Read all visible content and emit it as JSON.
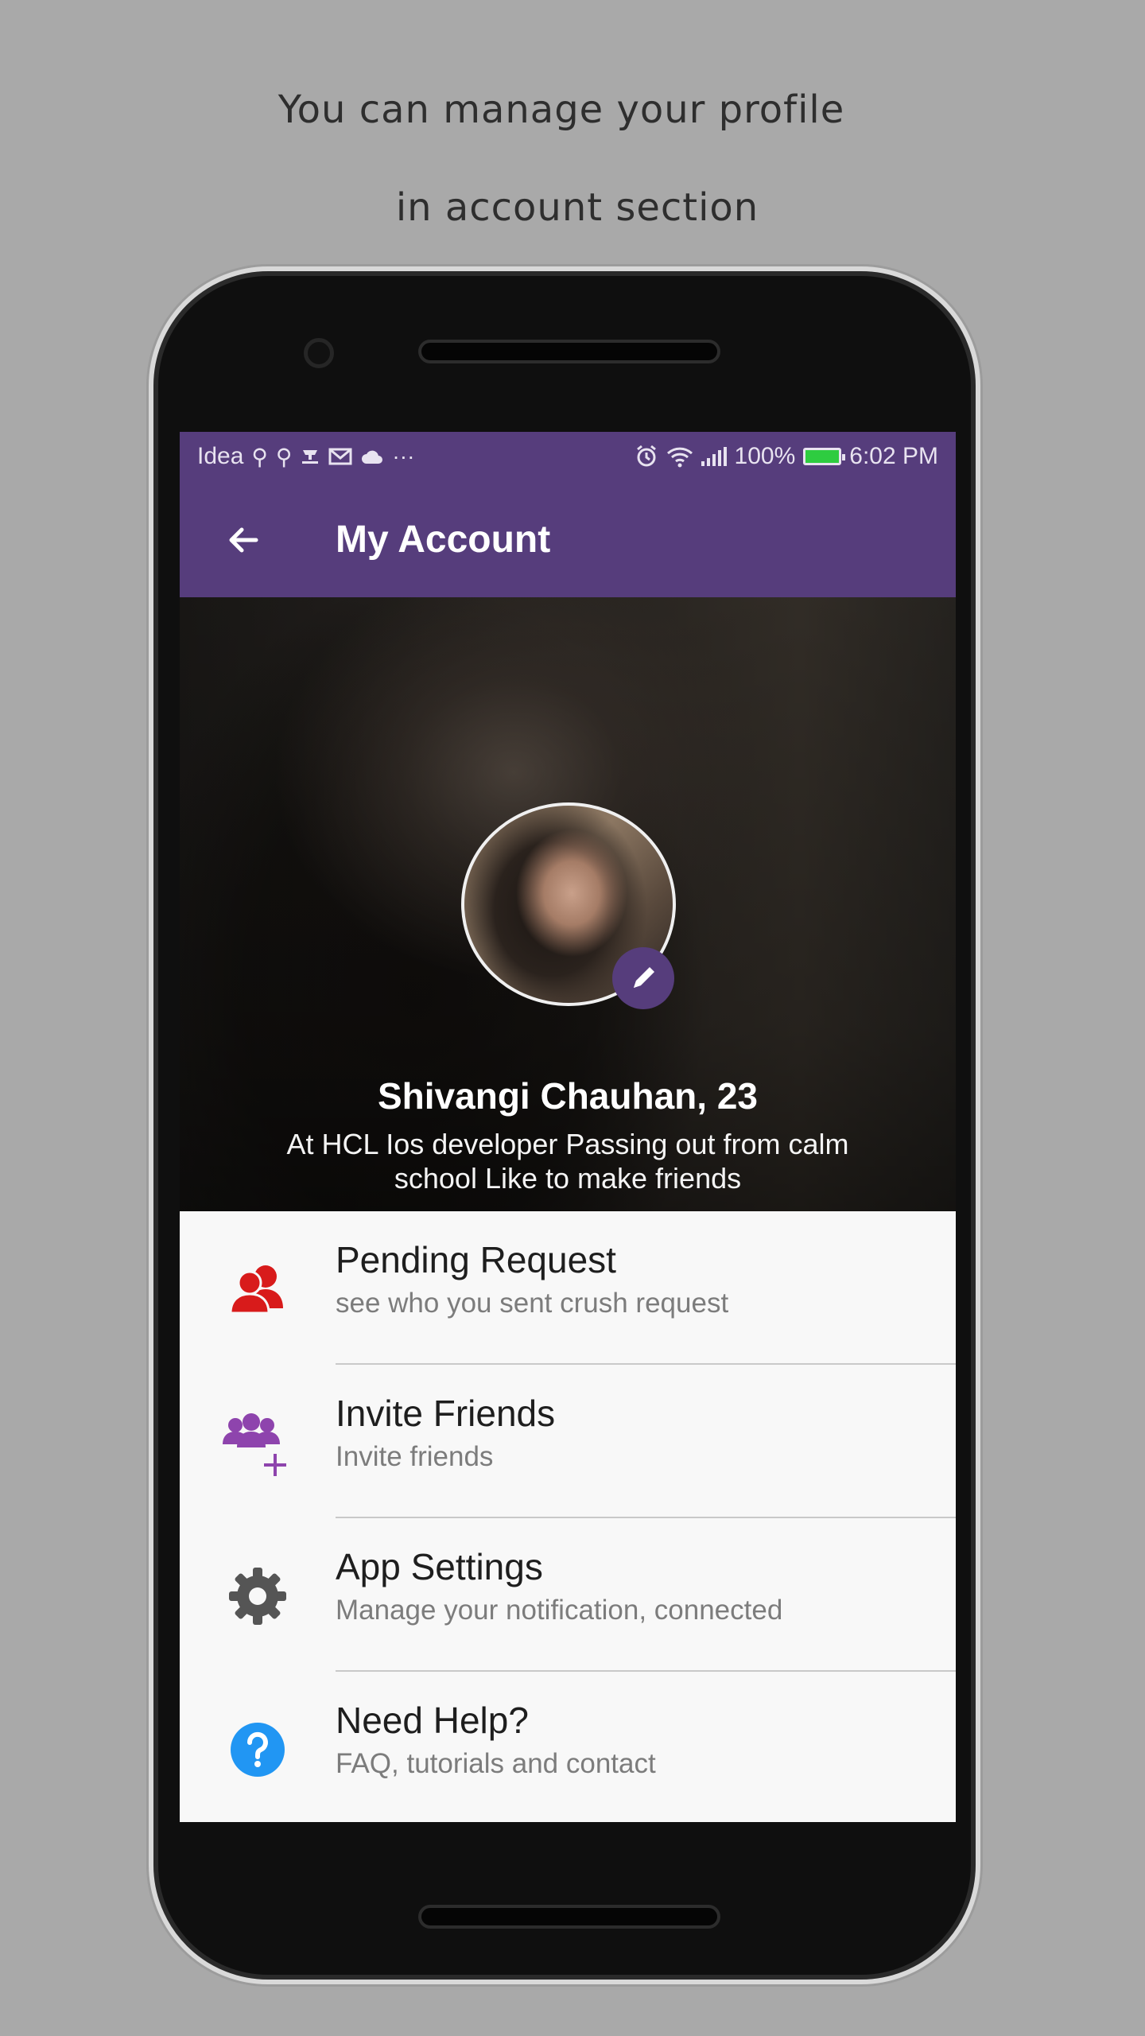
{
  "caption": {
    "line1": "You can manage your profile",
    "line2": "in account section"
  },
  "statusbar": {
    "carrier": "Idea",
    "notification_icons": [
      "usb-icon",
      "usb-icon",
      "download-icon",
      "gmail-icon",
      "cloud-icon",
      "more-icon"
    ],
    "battery_percent": "100%",
    "time": "6:02 PM",
    "battery_level": 1.0,
    "battery_color": "#2ecc40"
  },
  "appbar": {
    "title": "My Account",
    "back_icon": "arrow-back-icon",
    "color": "#563d7c"
  },
  "profile": {
    "name": "Shivangi Chauhan, 23",
    "bio": "At HCL Ios developer Passing out from calm school Like to make friends",
    "edit_icon": "pencil-icon"
  },
  "menu": {
    "items": [
      {
        "title": "Pending Request",
        "subtitle": "see who you sent crush request",
        "icon": "users-icon",
        "icon_color": "#d81b1b"
      },
      {
        "title": "Invite Friends",
        "subtitle": "Invite friends",
        "icon": "add-group-icon",
        "icon_color": "#8e44ad"
      },
      {
        "title": "App Settings",
        "subtitle": "Manage your notification, connected",
        "icon": "gear-icon",
        "icon_color": "#555555"
      },
      {
        "title": "Need Help?",
        "subtitle": "FAQ, tutorials and contact",
        "icon": "help-icon",
        "icon_color": "#2196f3"
      }
    ]
  }
}
